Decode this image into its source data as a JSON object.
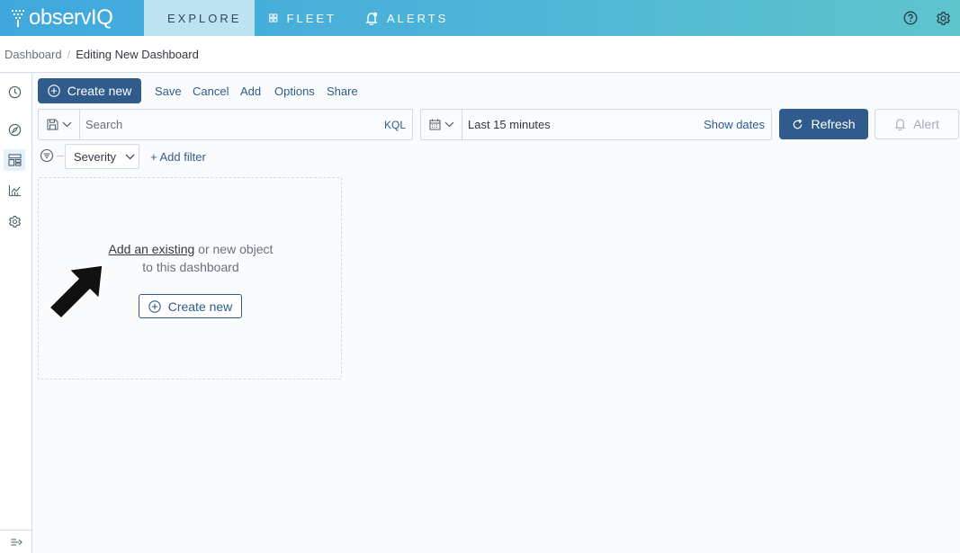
{
  "brand": {
    "logo_text_prefix": "observ",
    "logo_text_suffix": "IQ",
    "accent": "#2f5b8d"
  },
  "topnav": {
    "tabs": [
      {
        "label": "EXPLORE",
        "icon": "bar-chart-icon",
        "active": true
      },
      {
        "label": "FLEET",
        "icon": "grid-icon",
        "active": false
      },
      {
        "label": "ALERTS",
        "icon": "bell-icon",
        "active": false
      }
    ],
    "right_icons": [
      "help-icon",
      "gear-icon"
    ]
  },
  "breadcrumb": {
    "parent": "Dashboard",
    "current": "Editing New Dashboard"
  },
  "siderail": {
    "items": [
      "clock-icon",
      "compass-icon",
      "dashboard-icon",
      "visualize-icon",
      "settings-icon"
    ],
    "active": "dashboard-icon",
    "collapse_icon": "collapse-icon"
  },
  "toolbar": {
    "create_label": "Create new",
    "links": [
      "Save",
      "Cancel",
      "Add",
      "Options",
      "Share"
    ]
  },
  "query": {
    "search_placeholder": "Search",
    "language": "KQL",
    "time_range": "Last 15 minutes",
    "show_dates": "Show dates",
    "refresh_label": "Refresh",
    "alert_label": "Alert"
  },
  "filters": {
    "severity_label": "Severity",
    "add_filter": "+ Add filter"
  },
  "empty_state": {
    "link_text": "Add an existing",
    "text_rest_1": " or new object",
    "text_line_2": "to this dashboard",
    "create_label": "Create new"
  }
}
